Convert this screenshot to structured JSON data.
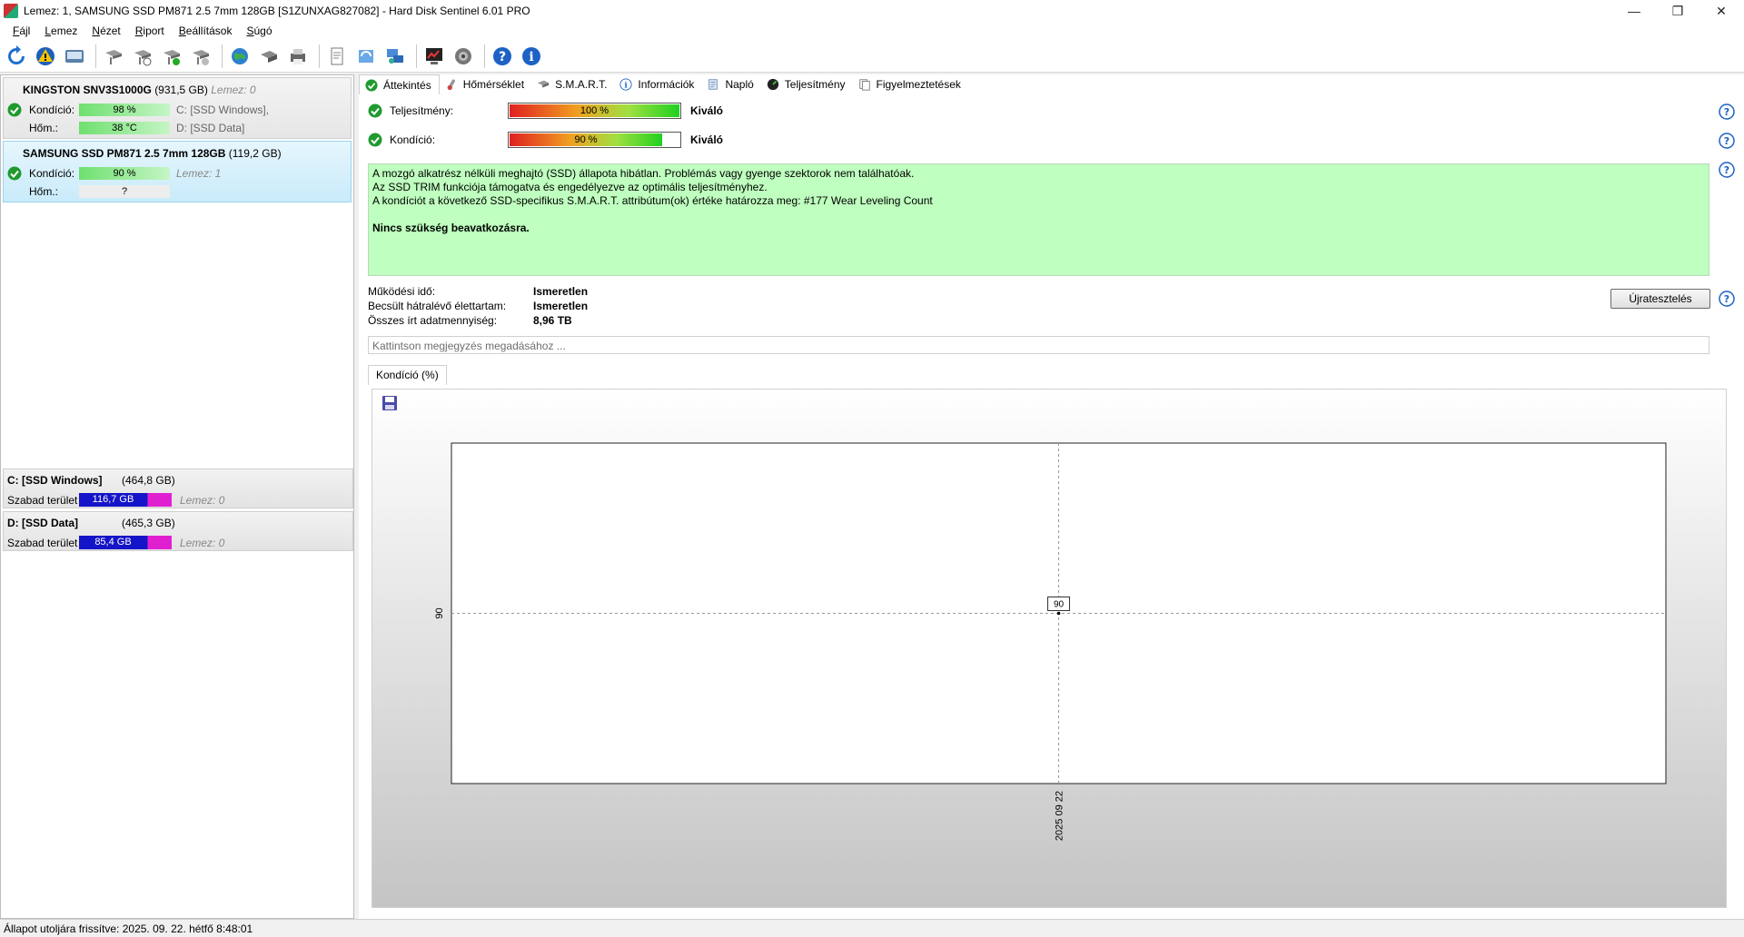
{
  "window": {
    "title": "Lemez: 1, SAMSUNG SSD PM871 2.5 7mm 128GB [S1ZUNXAG827082]  -  Hard Disk Sentinel 6.01 PRO",
    "minimize": "—",
    "maximize": "❐",
    "close": "✕"
  },
  "menu": [
    "Fájl",
    "Lemez",
    "Nézet",
    "Riport",
    "Beállítások",
    "Súgó"
  ],
  "disks": [
    {
      "name": "KINGSTON SNV3S1000G",
      "size": "(931,5 GB)",
      "lemez": "Lemez: 0",
      "kondicio_label": "Kondíció:",
      "kondicio_value": "98 %",
      "kondicio_percent": 98,
      "hom_label": "Hőm.:",
      "hom_value": "38 °C",
      "vol1": "C: [SSD Windows],",
      "vol2": "D: [SSD Data]"
    },
    {
      "name": "SAMSUNG SSD PM871 2.5 7mm 128GB",
      "size": "(119,2 GB)",
      "lemez": "Lemez: 1",
      "kondicio_label": "Kondíció:",
      "kondicio_value": "90 %",
      "kondicio_percent": 90,
      "hom_label": "Hőm.:",
      "hom_value": "?"
    }
  ],
  "partitions": [
    {
      "name": "C: [SSD Windows]",
      "size": "(464,8 GB)",
      "free_label": "Szabad terület",
      "free_value": "116,7 GB",
      "lemez": "Lemez: 0"
    },
    {
      "name": "D: [SSD Data]",
      "size": "(465,3 GB)",
      "free_label": "Szabad terület",
      "free_value": "85,4 GB",
      "lemez": "Lemez: 0"
    }
  ],
  "tabs": [
    "Áttekintés",
    "Hőmérséklet",
    "S.M.A.R.T.",
    "Információk",
    "Napló",
    "Teljesítmény",
    "Figyelmeztetések"
  ],
  "overview": {
    "performance_label": "Teljesítmény:",
    "performance_value": "100 %",
    "performance_percent": 100,
    "performance_result": "Kiváló",
    "condition_label": "Kondíció:",
    "condition_value": "90 %",
    "condition_percent": 90,
    "condition_result": "Kiváló",
    "info_lines": [
      "A mozgó alkatrész nélküli meghajtó (SSD) állapota hibátlan. Problémás vagy gyenge szektorok nem találhatóak.",
      "Az SSD TRIM funkciója támogatva és engedélyezve az optimális teljesítményhez.",
      "A kondíciót a következő SSD-specifikus S.M.A.R.T. attribútum(ok) értéke határozza meg:  #177 Wear Leveling Count"
    ],
    "info_strong": "Nincs szükség beavatkozásra.",
    "stats": [
      {
        "key": "Működési idő:",
        "value": "Ismeretlen"
      },
      {
        "key": "Becsült hátralévő élettartam:",
        "value": "Ismeretlen"
      },
      {
        "key": "Összes írt adatmennyiség:",
        "value": "8,96 TB"
      }
    ],
    "retest_label": "Újratesztelés",
    "note_placeholder": "Kattintson megjegyzés megadásához ...",
    "chart_tab": "Kondíció  (%)"
  },
  "chart_data": {
    "type": "line",
    "title": "Kondíció  (%)",
    "x": [
      "2025 09 22"
    ],
    "values": [
      90
    ],
    "data_labels": [
      "90"
    ],
    "y_tick_labels": [
      "90"
    ],
    "x_tick_labels": [
      "2025 09 22"
    ],
    "grid": true
  },
  "statusbar": "Állapot utoljára frissítve: 2025. 09. 22. hétfő 8:48:01",
  "colors": {
    "ok_green": "#1f9a2f",
    "info_bg": "#bfffbf",
    "selected_disk": "#c9ebfa",
    "free_space": "#1414c8",
    "used_space": "#e020d0"
  }
}
